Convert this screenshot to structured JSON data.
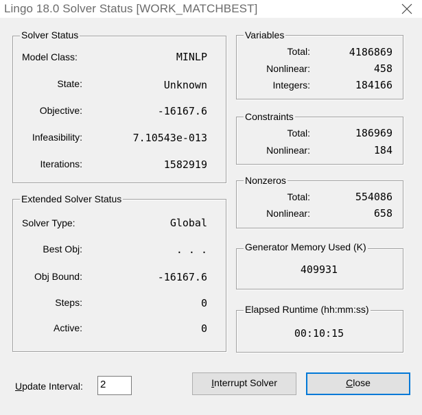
{
  "window": {
    "title": "Lingo 18.0 Solver Status [WORK_MATCHBEST]"
  },
  "solver_status": {
    "legend": "Solver Status",
    "model_class_label": "Model Class:",
    "model_class_value": "MINLP",
    "state_label": "State:",
    "state_value": "Unknown",
    "objective_label": "Objective:",
    "objective_value": "-16167.6",
    "infeasibility_label": "Infeasibility:",
    "infeasibility_value": "7.10543e-013",
    "iterations_label": "Iterations:",
    "iterations_value": "1582919"
  },
  "extended_status": {
    "legend": "Extended Solver Status",
    "solver_type_label": "Solver Type:",
    "solver_type_value": "Global",
    "best_obj_label": "Best Obj:",
    "best_obj_value": ". . .",
    "obj_bound_label": "Obj Bound:",
    "obj_bound_value": "-16167.6",
    "steps_label": "Steps:",
    "steps_value": "0",
    "active_label": "Active:",
    "active_value": "0"
  },
  "variables": {
    "legend": "Variables",
    "total_label": "Total:",
    "total_value": "4186869",
    "nonlinear_label": "Nonlinear:",
    "nonlinear_value": "458",
    "integers_label": "Integers:",
    "integers_value": "184166"
  },
  "constraints": {
    "legend": "Constraints",
    "total_label": "Total:",
    "total_value": "186969",
    "nonlinear_label": "Nonlinear:",
    "nonlinear_value": "184"
  },
  "nonzeros": {
    "legend": "Nonzeros",
    "total_label": "Total:",
    "total_value": "554086",
    "nonlinear_label": "Nonlinear:",
    "nonlinear_value": "658"
  },
  "generator_memory": {
    "legend": "Generator Memory Used (K)",
    "value": "409931"
  },
  "elapsed_runtime": {
    "legend": "Elapsed Runtime (hh:mm:ss)",
    "value": "00:10:15"
  },
  "footer": {
    "update_interval_label_accel": "U",
    "update_interval_label_rest": "pdate Interval:",
    "update_interval_value": "2",
    "interrupt_accel": "I",
    "interrupt_rest": "nterrupt Solver",
    "close_accel": "C",
    "close_rest": "lose"
  }
}
